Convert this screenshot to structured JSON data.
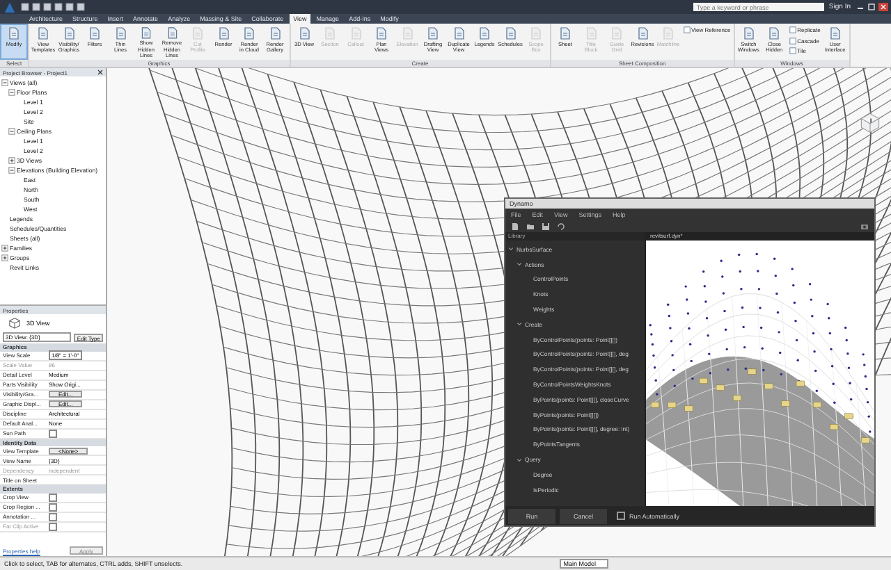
{
  "title_bar": {
    "search_placeholder": "Type a keyword or phrase",
    "sign_in": "Sign In"
  },
  "ribbon_tabs": [
    {
      "label": "Architecture",
      "selected": false
    },
    {
      "label": "Structure",
      "selected": false
    },
    {
      "label": "Insert",
      "selected": false
    },
    {
      "label": "Annotate",
      "selected": false
    },
    {
      "label": "Analyze",
      "selected": false
    },
    {
      "label": "Massing & Site",
      "selected": false
    },
    {
      "label": "Collaborate",
      "selected": false
    },
    {
      "label": "View",
      "selected": true
    },
    {
      "label": "Manage",
      "selected": false
    },
    {
      "label": "Add-Ins",
      "selected": false
    },
    {
      "label": "Modify",
      "selected": false
    }
  ],
  "ribbon_panels": [
    {
      "label": "Select",
      "buttons": [
        {
          "label": "Modify",
          "kind": "large",
          "selected": true,
          "disabled": false
        }
      ]
    },
    {
      "label": "Graphics",
      "buttons": [
        {
          "label": "View Templates",
          "kind": "large",
          "selected": false,
          "disabled": false
        },
        {
          "label": "Visibility/ Graphics",
          "kind": "large",
          "selected": false,
          "disabled": false
        },
        {
          "label": "Filters",
          "kind": "large",
          "selected": false,
          "disabled": false
        },
        {
          "label": "Thin Lines",
          "kind": "large",
          "selected": false,
          "disabled": false
        },
        {
          "label": "Show Hidden Lines",
          "kind": "large",
          "selected": false,
          "disabled": false
        },
        {
          "label": "Remove Hidden Lines",
          "kind": "large",
          "selected": false,
          "disabled": false
        },
        {
          "label": "Cut Profile",
          "kind": "large",
          "selected": false,
          "disabled": true
        },
        {
          "label": "Render",
          "kind": "large",
          "selected": false,
          "disabled": false
        },
        {
          "label": "Render in Cloud",
          "kind": "large",
          "selected": false,
          "disabled": false
        },
        {
          "label": "Render Gallery",
          "kind": "large",
          "selected": false,
          "disabled": false
        }
      ]
    },
    {
      "label": "Create",
      "buttons": [
        {
          "label": "3D View",
          "kind": "large",
          "selected": false,
          "disabled": false
        },
        {
          "label": "Section",
          "kind": "large",
          "selected": false,
          "disabled": true
        },
        {
          "label": "Callout",
          "kind": "large",
          "selected": false,
          "disabled": true
        },
        {
          "label": "Plan Views",
          "kind": "large",
          "selected": false,
          "disabled": false
        },
        {
          "label": "Elevation",
          "kind": "large",
          "selected": false,
          "disabled": true
        },
        {
          "label": "Drafting View",
          "kind": "large",
          "selected": false,
          "disabled": false
        },
        {
          "label": "Duplicate View",
          "kind": "large",
          "selected": false,
          "disabled": false
        },
        {
          "label": "Legends",
          "kind": "large",
          "selected": false,
          "disabled": false
        },
        {
          "label": "Schedules",
          "kind": "large",
          "selected": false,
          "disabled": false
        },
        {
          "label": "Scope Box",
          "kind": "large",
          "selected": false,
          "disabled": true
        }
      ]
    },
    {
      "label": "Sheet Composition",
      "buttons": [
        {
          "label": "Sheet",
          "kind": "large",
          "selected": false,
          "disabled": false
        },
        {
          "label": "Title Block",
          "kind": "large",
          "selected": false,
          "disabled": true
        },
        {
          "label": "Guide Grid",
          "kind": "large",
          "selected": false,
          "disabled": true
        },
        {
          "label": "Revisions",
          "kind": "large",
          "selected": false,
          "disabled": false
        },
        {
          "label": "Matchline",
          "kind": "large",
          "selected": false,
          "disabled": true
        },
        {
          "label": "View Reference",
          "kind": "small",
          "selected": false,
          "disabled": false
        }
      ]
    },
    {
      "label": "Windows",
      "buttons": [
        {
          "label": "Switch Windows",
          "kind": "large",
          "selected": false,
          "disabled": false
        },
        {
          "label": "Close Hidden",
          "kind": "large",
          "selected": false,
          "disabled": false
        },
        {
          "label": "Replicate",
          "kind": "small",
          "selected": false,
          "disabled": false
        },
        {
          "label": "Cascade",
          "kind": "small",
          "selected": false,
          "disabled": false
        },
        {
          "label": "Tile",
          "kind": "small",
          "selected": false,
          "disabled": false
        },
        {
          "label": "User Interface",
          "kind": "large",
          "selected": false,
          "disabled": false
        }
      ]
    }
  ],
  "project_browser": {
    "title": "Project Browser - Project1",
    "tree": [
      {
        "label": "Views (all)",
        "expanded": true,
        "children": [
          {
            "label": "Floor Plans",
            "expanded": true,
            "children": [
              {
                "label": "Level 1"
              },
              {
                "label": "Level 2"
              },
              {
                "label": "Site"
              }
            ]
          },
          {
            "label": "Ceiling Plans",
            "expanded": true,
            "children": [
              {
                "label": "Level 1"
              },
              {
                "label": "Level 2"
              }
            ]
          },
          {
            "label": "3D Views",
            "expanded": false
          },
          {
            "label": "Elevations (Building Elevation)",
            "expanded": true,
            "children": [
              {
                "label": "East"
              },
              {
                "label": "North"
              },
              {
                "label": "South"
              },
              {
                "label": "West"
              }
            ]
          }
        ]
      },
      {
        "label": "Legends"
      },
      {
        "label": "Schedules/Quantities"
      },
      {
        "label": "Sheets (all)"
      },
      {
        "label": "Families",
        "expanded": false
      },
      {
        "label": "Groups",
        "expanded": false
      },
      {
        "label": "Revit Links"
      }
    ]
  },
  "properties": {
    "title": "Properties",
    "type_name": "3D View",
    "type_selector": "3D View: {3D}",
    "edit_type": "Edit Type",
    "sections": [
      {
        "label": "Graphics",
        "rows": [
          {
            "label": "View Scale",
            "kind": "field",
            "value": "1/8\" = 1'-0\"",
            "disabled": false
          },
          {
            "label": "Scale Value",
            "kind": "text",
            "value": "96",
            "disabled": true
          },
          {
            "label": "Detail Level",
            "kind": "text",
            "value": "Medium",
            "disabled": false
          },
          {
            "label": "Parts Visibility",
            "kind": "text",
            "value": "Show Origi...",
            "disabled": false
          },
          {
            "label": "Visibility/Gra...",
            "kind": "button",
            "value": "Edit...",
            "disabled": false
          },
          {
            "label": "Graphic Displ...",
            "kind": "button",
            "value": "Edit...",
            "disabled": false
          },
          {
            "label": "Discipline",
            "kind": "text",
            "value": "Architectural",
            "disabled": false
          },
          {
            "label": "Default Anal...",
            "kind": "text",
            "value": "None",
            "disabled": false
          },
          {
            "label": "Sun Path",
            "kind": "checkbox",
            "checked": false,
            "disabled": false
          }
        ]
      },
      {
        "label": "Identity Data",
        "rows": [
          {
            "label": "View Template",
            "kind": "button",
            "value": "<None>",
            "disabled": false
          },
          {
            "label": "View Name",
            "kind": "text",
            "value": "{3D}",
            "disabled": false
          },
          {
            "label": "Dependency",
            "kind": "text",
            "value": "Independent",
            "disabled": true
          },
          {
            "label": "Title on Sheet",
            "kind": "text",
            "disabled": false
          }
        ]
      },
      {
        "label": "Extents",
        "rows": [
          {
            "label": "Crop View",
            "kind": "checkbox",
            "checked": false,
            "disabled": false
          },
          {
            "label": "Crop Region ...",
            "kind": "checkbox",
            "checked": false,
            "disabled": false
          },
          {
            "label": "Annotation ...",
            "kind": "checkbox",
            "checked": false,
            "disabled": false
          },
          {
            "label": "Far Clip Active",
            "kind": "checkbox",
            "checked": false,
            "disabled": true
          }
        ]
      }
    ],
    "help_link": "Properties help",
    "apply": "Apply"
  },
  "dynamo": {
    "title": "Dynamo",
    "menu": [
      "File",
      "Edit",
      "View",
      "Settings",
      "Help"
    ],
    "library_label": "Library",
    "tab": "revitsurf.dyn*",
    "library": [
      {
        "label": "NurbsSurface",
        "expanded": true,
        "children": [
          {
            "label": "Actions",
            "expanded": true,
            "children": [
              {
                "label": "ControlPoints"
              },
              {
                "label": "Knots"
              },
              {
                "label": "Weights"
              }
            ]
          },
          {
            "label": "Create",
            "expanded": true,
            "children": [
              {
                "label": "ByControlPoints(points: Point[][])"
              },
              {
                "label": "ByControlPoints(points: Point[][], deg"
              },
              {
                "label": "ByControlPoints(points: Point[][], deg"
              },
              {
                "label": "ByControlPointsWeightsKnots"
              },
              {
                "label": "ByPoints(points: Point[][], closeCurve"
              },
              {
                "label": "ByPoints(points: Point[][])"
              },
              {
                "label": "ByPoints(points: Point[][], degree: int)"
              },
              {
                "label": "ByPointsTangents"
              }
            ]
          },
          {
            "label": "Query",
            "expanded": true,
            "children": [
              {
                "label": "Degree"
              },
              {
                "label": "IsPeriodic"
              }
            ]
          }
        ]
      }
    ],
    "run": "Run",
    "cancel": "Cancel",
    "run_automatically": {
      "label": "Run Automatically",
      "checked": false
    }
  },
  "status_bar": {
    "text": "Click to select, TAB for alternates, CTRL adds, SHIFT unselects.",
    "model": "Main Model"
  }
}
